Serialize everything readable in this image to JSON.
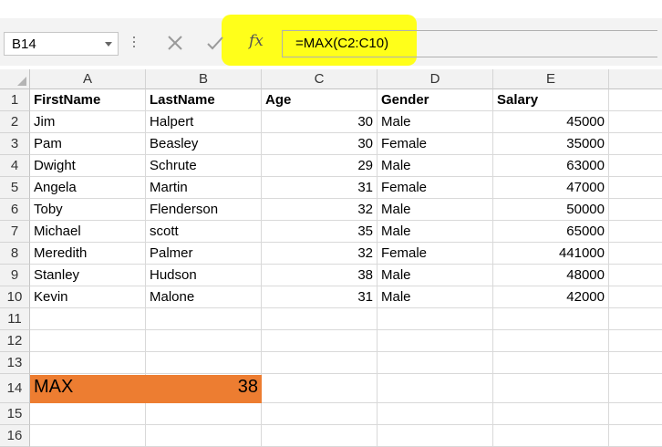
{
  "formula_bar": {
    "name_box": "B14",
    "fx_label": "fx",
    "formula": "=MAX(C2:C10)"
  },
  "icons": {
    "cancel": "close-icon",
    "enter": "check-icon",
    "insert_function": "fx-icon",
    "name_box_dropdown": "chevron-down-icon"
  },
  "highlight_color": "#ffff1a",
  "max_band_color": "#ed7d31",
  "columns": [
    "A",
    "B",
    "C",
    "D",
    "E"
  ],
  "row_numbers": [
    "1",
    "2",
    "3",
    "4",
    "5",
    "6",
    "7",
    "8",
    "9",
    "10",
    "11",
    "12",
    "13",
    "14",
    "15",
    "16"
  ],
  "header_row": [
    "FirstName",
    "LastName",
    "Age",
    "Gender",
    "Salary"
  ],
  "data_rows": [
    [
      "Jim",
      "Halpert",
      "30",
      "Male",
      "45000"
    ],
    [
      "Pam",
      "Beasley",
      "30",
      "Female",
      "35000"
    ],
    [
      "Dwight",
      "Schrute",
      "29",
      "Male",
      "63000"
    ],
    [
      "Angela",
      "Martin",
      "31",
      "Female",
      "47000"
    ],
    [
      "Toby",
      "Flenderson",
      "32",
      "Male",
      "50000"
    ],
    [
      "Michael",
      "scott",
      "35",
      "Male",
      "65000"
    ],
    [
      "Meredith",
      "Palmer",
      "32",
      "Female",
      "441000"
    ],
    [
      "Stanley",
      "Hudson",
      "38",
      "Male",
      "48000"
    ],
    [
      "Kevin",
      "Malone",
      "31",
      "Male",
      "42000"
    ]
  ],
  "max_row": {
    "label": "MAX",
    "value": "38"
  }
}
